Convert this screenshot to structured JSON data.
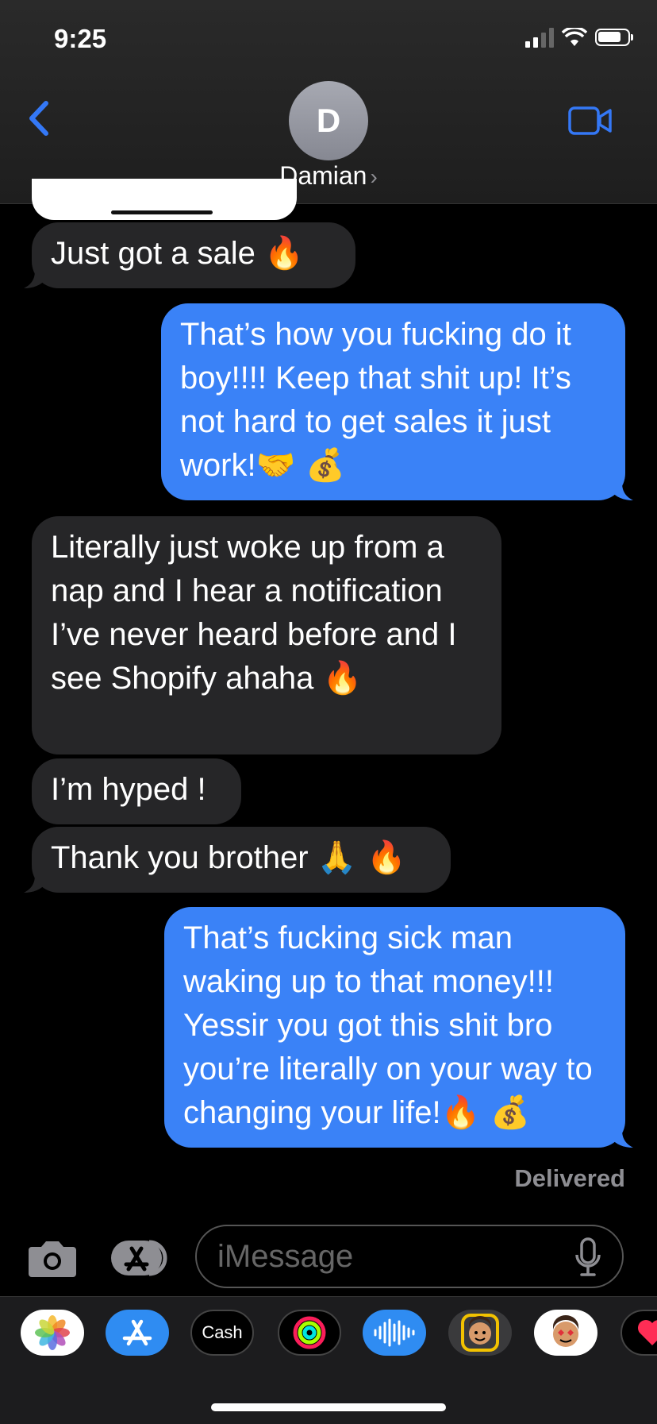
{
  "status_bar": {
    "time": "9:25"
  },
  "header": {
    "avatar_initial": "D",
    "contact_name": "Damian",
    "chevron": "›"
  },
  "messages": [
    {
      "from": "them",
      "text": "Just got a sale ",
      "emoji": "🔥"
    },
    {
      "from": "me",
      "text": "That’s how you fucking do it boy!!!!  Keep that shit up! It’s not hard to get sales it just work!",
      "emoji": "🤝 💰"
    },
    {
      "from": "them",
      "text": "Literally just woke up from a nap and I hear a notification I’ve never heard before and I see Shopify ahaha ",
      "emoji": "🔥"
    },
    {
      "from": "them",
      "text": "I’m hyped !"
    },
    {
      "from": "them",
      "text": "Thank you brother ",
      "emoji": "🙏 🔥"
    },
    {
      "from": "me",
      "text": "That’s fucking sick man waking up to that money!!! Yessir you got this shit bro you’re literally on your way to changing your life!",
      "emoji": "🔥 💰"
    }
  ],
  "delivered_label": "Delivered",
  "compose": {
    "placeholder": "iMessage"
  },
  "app_drawer": [
    {
      "name": "Photos",
      "icon": "photos-icon"
    },
    {
      "name": "App Store",
      "icon": "appstore-icon"
    },
    {
      "name": "Cash",
      "label": "Cash",
      "icon": "apple-cash-icon"
    },
    {
      "name": "Activity",
      "icon": "activity-icon"
    },
    {
      "name": "Audio",
      "icon": "audio-waveform-icon"
    },
    {
      "name": "Memoji",
      "icon": "memoji-icon"
    },
    {
      "name": "Memoji Stickers",
      "icon": "memoji-stickers-icon"
    },
    {
      "name": "Digital Touch",
      "icon": "digital-touch-icon"
    }
  ],
  "colors": {
    "outgoing": "#3a82f7",
    "incoming": "#262628",
    "accent": "#3478f6"
  }
}
